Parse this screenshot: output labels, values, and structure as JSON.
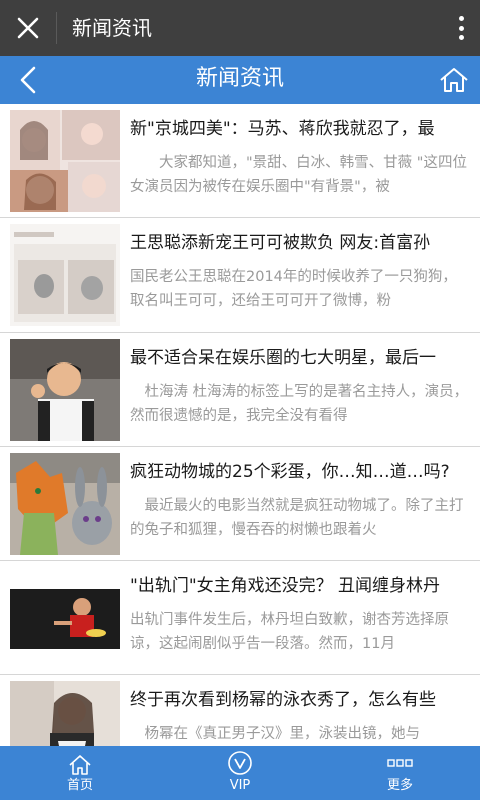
{
  "topbar": {
    "title": "新闻资讯"
  },
  "navbar": {
    "title": "新闻资讯"
  },
  "articles": [
    {
      "title": "新\"京城四美\"：马苏、蒋欣我就忍了，最",
      "summary": "大家都知道，\"景甜、白冰、韩雪、甘薇 \"这四位女演员因为被传在娱乐圈中\"有背景\"，被"
    },
    {
      "title": "王思聪添新宠王可可被欺负 网友:首富孙",
      "summary": "国民老公王思聪在2014年的时候收养了一只狗狗，取名叫王可可，还给王可可开了微博，粉"
    },
    {
      "title": "最不适合呆在娱乐圈的七大明星，最后一",
      "summary": "杜海涛      杜海涛的标签上写的是著名主持人，演员，然而很遗憾的是，我完全没有看得"
    },
    {
      "title": "疯狂动物城的25个彩蛋，你…知…道…吗?",
      "summary": "最近最火的电影当然就是疯狂动物城了。除了主打的兔子和狐狸，慢吞吞的树懒也跟着火"
    },
    {
      "title": "\"出轨门\"女主角戏还没完？ 丑闻缠身林丹",
      "summary": "出轨门事件发生后，林丹坦白致歉，谢杏芳选择原谅，这起闹剧似乎告一段落。然而，11月"
    },
    {
      "title": "终于再次看到杨幂的泳衣秀了，怎么有些",
      "summary": "杨幂在《真正男子汉》里，泳装出镜，她与"
    }
  ],
  "tabbar": {
    "home": "首页",
    "vip": "VIP",
    "more": "更多"
  }
}
